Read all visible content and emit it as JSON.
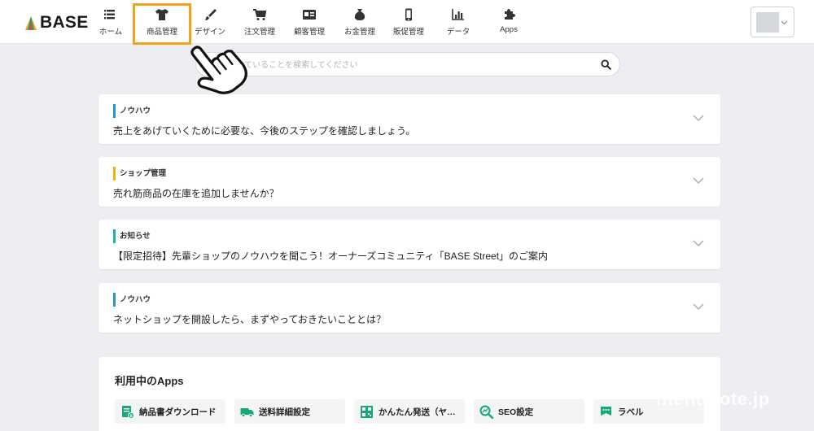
{
  "header": {
    "logo_text": "BASE",
    "nav": [
      {
        "label": "ホーム",
        "icon": "home-icon"
      },
      {
        "label": "商品管理",
        "icon": "tshirt-icon"
      },
      {
        "label": "デザイン",
        "icon": "brush-icon"
      },
      {
        "label": "注文管理",
        "icon": "cart-icon"
      },
      {
        "label": "顧客管理",
        "icon": "id-card-icon"
      },
      {
        "label": "お金管理",
        "icon": "money-bag-icon"
      },
      {
        "label": "販促管理",
        "icon": "phone-icon"
      },
      {
        "label": "データ",
        "icon": "bar-chart-icon"
      },
      {
        "label": "Apps",
        "icon": "puzzle-icon"
      }
    ],
    "active_index": 1
  },
  "search": {
    "placeholder": "と、困っていることを検索してください"
  },
  "cards": [
    {
      "category": "ノウハウ",
      "color": "#1a9bd7",
      "message": "売上をあげていくために必要な、今後のステップを確認しましょう。"
    },
    {
      "category": "ショップ管理",
      "color": "#f0b400",
      "message": "売れ筋商品の在庫を追加しませんか？"
    },
    {
      "category": "お知らせ",
      "color": "#18b5a8",
      "message": "【限定招待】先輩ショップのノウハウを聞こう！オーナーズコミュニティ「BASE Street」のご案内"
    },
    {
      "category": "ノウハウ",
      "color": "#1a9bd7",
      "message": "ネットショップを開設したら、まずやっておきたいこととは？"
    }
  ],
  "apps": {
    "title": "利用中のApps",
    "items": [
      {
        "label": "納品書ダウンロード",
        "icon": "invoice-icon"
      },
      {
        "label": "送料詳細設定",
        "icon": "truck-icon"
      },
      {
        "label": "かんたん発送（ヤ…",
        "icon": "qr-box-icon"
      },
      {
        "label": "SEO設定",
        "icon": "seo-chart-icon"
      },
      {
        "label": "ラベル",
        "icon": "label-icon"
      }
    ]
  },
  "watermark": "ntent-note.jp",
  "colors": {
    "accent_highlight": "#f3a21a",
    "app_icon_green": "#16a878",
    "background": "#eceef1"
  }
}
